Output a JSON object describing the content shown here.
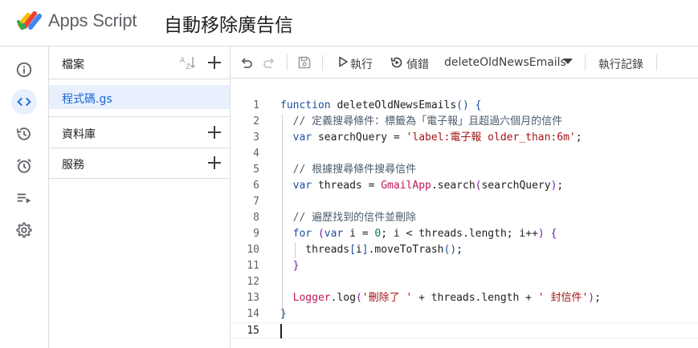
{
  "header": {
    "app_name": "Apps Script",
    "project_title": "自動移除廣告信"
  },
  "rail": {
    "items": [
      {
        "icon": "info-icon",
        "label": "總覽"
      },
      {
        "icon": "code-icon",
        "label": "編輯器",
        "active": true
      },
      {
        "icon": "history-icon",
        "label": "版本記錄"
      },
      {
        "icon": "alarm-icon",
        "label": "觸發條件"
      },
      {
        "icon": "executions-icon",
        "label": "執行作業"
      },
      {
        "icon": "gear-icon",
        "label": "專案設定"
      }
    ]
  },
  "files_panel": {
    "title": "檔案",
    "files": [
      "程式碼.gs"
    ],
    "sections": [
      "資料庫",
      "服務"
    ]
  },
  "toolbar": {
    "run_label": "執行",
    "debug_label": "偵錯",
    "function_name": "deleteOldNewsEmails",
    "log_label": "執行記錄"
  },
  "editor": {
    "line_numbers": [
      "1",
      "2",
      "3",
      "4",
      "5",
      "6",
      "7",
      "8",
      "9",
      "10",
      "11",
      "12",
      "13",
      "14",
      "15"
    ],
    "lines": [
      [
        {
          "t": "kw",
          "v": "function"
        },
        {
          "t": "p",
          "v": " deleteOldNewsEmails"
        },
        {
          "t": "br1",
          "v": "("
        },
        {
          "t": "br1",
          "v": ")"
        },
        {
          "t": "p",
          "v": " "
        },
        {
          "t": "br1",
          "v": "{"
        }
      ],
      [
        {
          "t": "p",
          "v": "  "
        },
        {
          "t": "cm",
          "v": "// 定義搜尋條件：標籤為「電子報」且超過六個月的信件"
        }
      ],
      [
        {
          "t": "p",
          "v": "  "
        },
        {
          "t": "kw",
          "v": "var"
        },
        {
          "t": "p",
          "v": " searchQuery = "
        },
        {
          "t": "str",
          "v": "'label:電子報 older_than:6m'"
        },
        {
          "t": "p",
          "v": ";"
        }
      ],
      [],
      [
        {
          "t": "p",
          "v": "  "
        },
        {
          "t": "cm",
          "v": "// 根據搜尋條件搜尋信件"
        }
      ],
      [
        {
          "t": "p",
          "v": "  "
        },
        {
          "t": "kw",
          "v": "var"
        },
        {
          "t": "p",
          "v": " threads = "
        },
        {
          "t": "obj",
          "v": "GmailApp"
        },
        {
          "t": "p",
          "v": ".search"
        },
        {
          "t": "br2",
          "v": "("
        },
        {
          "t": "p",
          "v": "searchQuery"
        },
        {
          "t": "br2",
          "v": ")"
        },
        {
          "t": "p",
          "v": ";"
        }
      ],
      [],
      [
        {
          "t": "p",
          "v": "  "
        },
        {
          "t": "cm",
          "v": "// 遍歷找到的信件並刪除"
        }
      ],
      [
        {
          "t": "p",
          "v": "  "
        },
        {
          "t": "kw",
          "v": "for"
        },
        {
          "t": "p",
          "v": " "
        },
        {
          "t": "br2",
          "v": "("
        },
        {
          "t": "kw",
          "v": "var"
        },
        {
          "t": "p",
          "v": " i = "
        },
        {
          "t": "num",
          "v": "0"
        },
        {
          "t": "p",
          "v": "; i < threads.length; i++"
        },
        {
          "t": "br2",
          "v": ")"
        },
        {
          "t": "p",
          "v": " "
        },
        {
          "t": "br2",
          "v": "{"
        }
      ],
      [
        {
          "t": "p",
          "v": "    threads"
        },
        {
          "t": "br1",
          "v": "["
        },
        {
          "t": "p",
          "v": "i"
        },
        {
          "t": "br1",
          "v": "]"
        },
        {
          "t": "p",
          "v": ".moveToTrash"
        },
        {
          "t": "br1",
          "v": "("
        },
        {
          "t": "br1",
          "v": ")"
        },
        {
          "t": "p",
          "v": ";"
        }
      ],
      [
        {
          "t": "p",
          "v": "  "
        },
        {
          "t": "br2",
          "v": "}"
        }
      ],
      [],
      [
        {
          "t": "p",
          "v": "  "
        },
        {
          "t": "obj",
          "v": "Logger"
        },
        {
          "t": "p",
          "v": ".log"
        },
        {
          "t": "br2",
          "v": "("
        },
        {
          "t": "str",
          "v": "'刪除了 '"
        },
        {
          "t": "p",
          "v": " + threads.length + "
        },
        {
          "t": "str",
          "v": "' 封信件'"
        },
        {
          "t": "br2",
          "v": ")"
        },
        {
          "t": "p",
          "v": ";"
        }
      ],
      [
        {
          "t": "br1",
          "v": "}"
        }
      ],
      []
    ]
  }
}
